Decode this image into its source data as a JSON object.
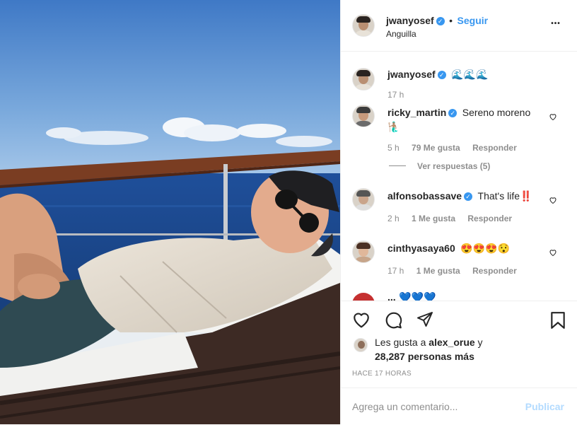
{
  "post": {
    "author": "jwanyosef",
    "location": "Anguilla",
    "follow_label": "Seguir",
    "dot": "•",
    "more": "•••",
    "caption": "🌊🌊🌊",
    "caption_time": "17 h"
  },
  "comments": [
    {
      "user": "ricky_martin",
      "verified": true,
      "text": "Sereno moreno",
      "emoji_line": "🧜🏽‍♂️",
      "time": "5 h",
      "likes": "79 Me gusta",
      "reply": "Responder",
      "view_replies": "Ver respuestas (5)"
    },
    {
      "user": "alfonsobassave",
      "verified": true,
      "text": "That's life",
      "emoji": "‼️",
      "time": "2 h",
      "likes": "1 Me gusta",
      "reply": "Responder"
    },
    {
      "user": "cinthyasaya60",
      "verified": false,
      "text": "😍😍😍😯",
      "time": "17 h",
      "likes": "1 Me gusta",
      "reply": "Responder"
    },
    {
      "user": "...",
      "partial_text": "💙💙💙"
    }
  ],
  "likes_line": {
    "prefix": "Les gusta a",
    "user": "alex_orue",
    "suffix": "y",
    "count": "28,287 personas más"
  },
  "timestamp": "HACE 17 HORAS",
  "add_comment": {
    "placeholder": "Agrega un comentario...",
    "post_label": "Publicar"
  },
  "colors": {
    "blue": "#3897f0",
    "publish_disabled": "#b3dbff",
    "gray": "#8e8e8e",
    "text": "#262626"
  },
  "icons": {
    "like": "heart-icon",
    "comment": "comment-bubble-icon",
    "share": "paper-plane-icon",
    "save": "bookmark-icon",
    "more": "ellipsis-icon",
    "verified": "verified-badge-icon"
  }
}
